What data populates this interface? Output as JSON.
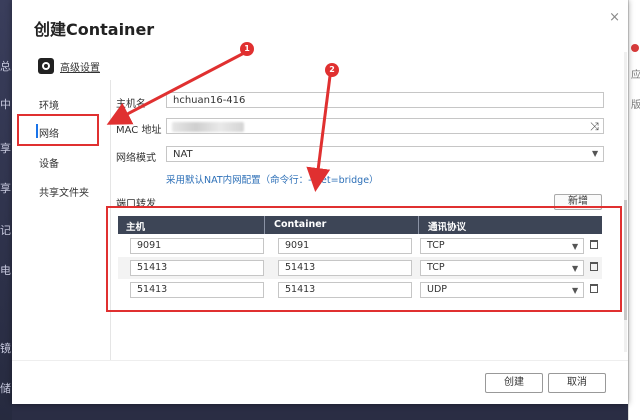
{
  "background": {
    "left_glyphs": [
      "总",
      "中",
      "享",
      "享",
      "记",
      "电",
      "镜",
      "储"
    ],
    "right_glyphs": [
      "应",
      "版"
    ]
  },
  "dialog": {
    "title": "创建Container",
    "close": "×"
  },
  "sidebar": {
    "advanced_label": "高级设置",
    "items": [
      {
        "label": "环境"
      },
      {
        "label": "网络"
      },
      {
        "label": "设备"
      },
      {
        "label": "共享文件夹"
      }
    ]
  },
  "form": {
    "hostname_label": "主机名",
    "hostname_value": "hchuan16-416",
    "mac_label": "MAC 地址",
    "network_mode_label": "网络模式",
    "network_mode_value": "NAT",
    "hint": "采用默认NAT内网配置（命令行：--net=bridge）"
  },
  "ports": {
    "title": "端口转发",
    "add_label": "新增",
    "columns": [
      "主机",
      "Container",
      "通讯协议"
    ],
    "rows": [
      {
        "host": "9091",
        "container": "9091",
        "protocol": "TCP"
      },
      {
        "host": "51413",
        "container": "51413",
        "protocol": "TCP"
      },
      {
        "host": "51413",
        "container": "51413",
        "protocol": "UDP"
      }
    ]
  },
  "footer": {
    "create_label": "创建",
    "cancel_label": "取消"
  },
  "annotations": {
    "badge1": "1",
    "badge2": "2",
    "color": "#e03030"
  }
}
